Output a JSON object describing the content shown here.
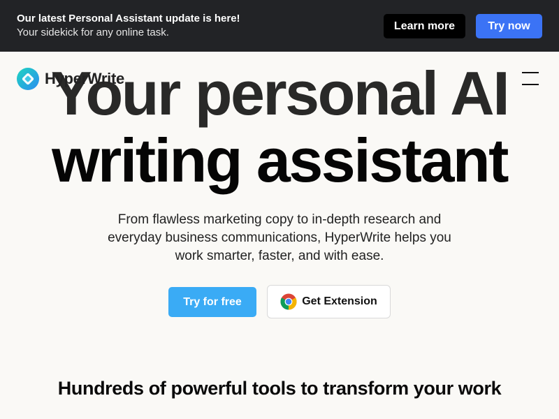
{
  "banner": {
    "title": "Our latest Personal Assistant update is here!",
    "subtitle": "Your sidekick for any online task.",
    "learn_more_label": "Learn more",
    "try_now_label": "Try now"
  },
  "header": {
    "logo_text": "HyperWrite",
    "logo_icon": "hyperwrite-logo-icon",
    "menu_icon": "hamburger-menu-icon"
  },
  "hero": {
    "title_line1": "Your personal AI",
    "title_line2": "writing assistant",
    "description": "From flawless marketing copy to in-depth research and everyday business communications, HyperWrite helps you work smarter, faster, and with ease.",
    "try_free_label": "Try for free",
    "extension_label": "Get Extension",
    "extension_icon": "chrome-icon"
  },
  "tools": {
    "heading": "Hundreds of powerful tools to transform your work"
  },
  "colors": {
    "banner_bg": "#222326",
    "learn_more_bg": "#000000",
    "try_now_bg": "#3b73f5",
    "try_free_bg": "#3aabf5",
    "page_bg": "#faf9f6"
  }
}
